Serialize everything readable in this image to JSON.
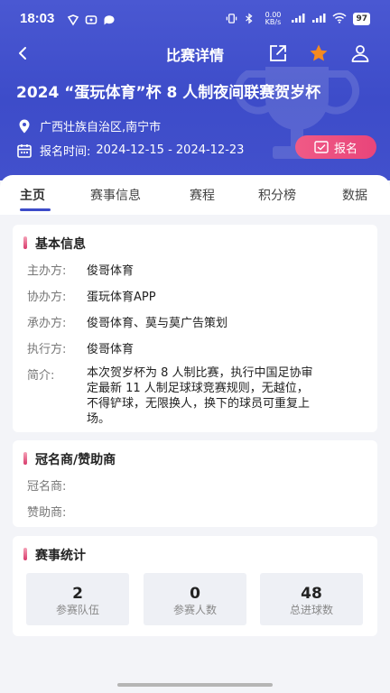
{
  "status_bar": {
    "time": "18:03",
    "net_speed": "0.00 KB/s",
    "signal": "4G",
    "battery": "97"
  },
  "nav": {
    "title": "比赛详情"
  },
  "match": {
    "title": "2024 “蛋玩体育”杯 8 人制夜间联赛贺岁杯",
    "location": "广西壮族自治区,南宁市",
    "reg_label": "报名时间:",
    "reg_range": "2024-12-15 - 2024-12-23",
    "signup_label": "报名"
  },
  "tabs": [
    {
      "label": "主页",
      "active": true
    },
    {
      "label": "赛事信息"
    },
    {
      "label": "赛程"
    },
    {
      "label": "积分榜"
    },
    {
      "label": "数据"
    }
  ],
  "basic_info": {
    "title": "基本信息",
    "rows": [
      {
        "label": "主办方:",
        "value": "俊哥体育"
      },
      {
        "label": "协办方:",
        "value": "蛋玩体育APP"
      },
      {
        "label": "承办方:",
        "value": "俊哥体育、莫与莫广告策划"
      },
      {
        "label": "执行方:",
        "value": "俊哥体育"
      }
    ],
    "intro_label": "简介:",
    "intro_lines": [
      "本次贺岁杯为 8 人制比赛，执行中国足协审",
      "定最新 11 人制足球球竞赛规则，无越位，",
      "不得铲球，无限换人，换下的球员可重复上",
      "场。"
    ]
  },
  "sponsors": {
    "title": "冠名商/赞助商",
    "rows": [
      {
        "label": "冠名商:",
        "value": ""
      },
      {
        "label": "赞助商:",
        "value": ""
      }
    ]
  },
  "stats": {
    "title": "赛事统计",
    "items": [
      {
        "value": "2",
        "label": "参赛队伍"
      },
      {
        "value": "0",
        "label": "参赛人数"
      },
      {
        "value": "48",
        "label": "总进球数"
      }
    ]
  },
  "colors": {
    "header": "#3d4cc9",
    "accent_pink": "#e8457a",
    "page_bg": "#f3f4f8"
  }
}
